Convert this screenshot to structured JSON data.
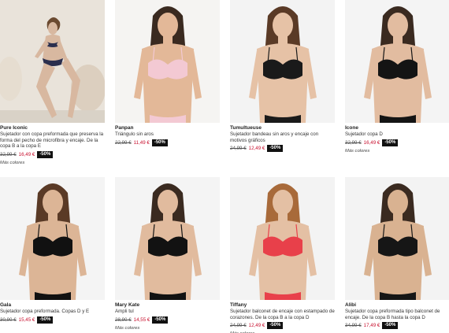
{
  "products": [
    {
      "name": "Pure Iconic",
      "description": "Sujetador con copa preformada que preserva la forma del pecho de microfibra y encaje. De la copa B a la copa E",
      "old_price": "32,99 €",
      "new_price": "16,49 €",
      "discount": "-50%",
      "more_colors": "Más colores",
      "lingerie_color": "#2b2f4e",
      "skin": "#d8b8a0",
      "bg": "#e9e3da"
    },
    {
      "name": "Panpan",
      "description": "Triángulo sin aros",
      "old_price": "22,99 €",
      "new_price": "11,49 €",
      "discount": "-50%",
      "more_colors": "",
      "lingerie_color": "#f3c9d3",
      "skin": "#e3b898",
      "bg": "#f5f4f2"
    },
    {
      "name": "Tumultueuse",
      "description": "Sujetador bandeau sin aros y encaje con motivos gráficos",
      "old_price": "24,99 €",
      "new_price": "12,49 €",
      "discount": "-50%",
      "more_colors": "",
      "lingerie_color": "#1a1a1a",
      "skin": "#e6c2a6",
      "bg": "#f3f3f3"
    },
    {
      "name": "Icone",
      "description": "Sujetador copa D",
      "old_price": "32,99 €",
      "new_price": "16,49 €",
      "discount": "-50%",
      "more_colors": "Más colores",
      "lingerie_color": "#141414",
      "skin": "#e2bca0",
      "bg": "#f4f4f4"
    },
    {
      "name": "Gala",
      "description": "Sujetador copa preformada. Copas D y E",
      "old_price": "30,90 €",
      "new_price": "15,45 €",
      "discount": "-50%",
      "more_colors": "",
      "lingerie_color": "#111111",
      "skin": "#dcb596",
      "bg": "#f4f4f4"
    },
    {
      "name": "Mary Kate",
      "description": "Ampli tul",
      "old_price": "28,90 €",
      "new_price": "14,55 €",
      "discount": "-50%",
      "more_colors": "Más colores",
      "lingerie_color": "#121212",
      "skin": "#e1bb9e",
      "bg": "#f4f4f4"
    },
    {
      "name": "Tiffany",
      "description": "Sujetador balconet de encaje con estampado de corazones. De la copa B a la copa D",
      "old_price": "24,99 €",
      "new_price": "12,49 €",
      "discount": "-50%",
      "more_colors": "Más colores",
      "lingerie_color": "#e8404a",
      "skin": "#e4c0a4",
      "bg": "#f3f3f3"
    },
    {
      "name": "Alibi",
      "description": "Sujetador copa preformada tipo balconet de encaje. De la copa B hasta la copa D",
      "old_price": "34,99 €",
      "new_price": "17,49 €",
      "discount": "-50%",
      "more_colors": "",
      "lingerie_color": "#161616",
      "skin": "#d9b291",
      "bg": "#f3f3f3"
    }
  ]
}
